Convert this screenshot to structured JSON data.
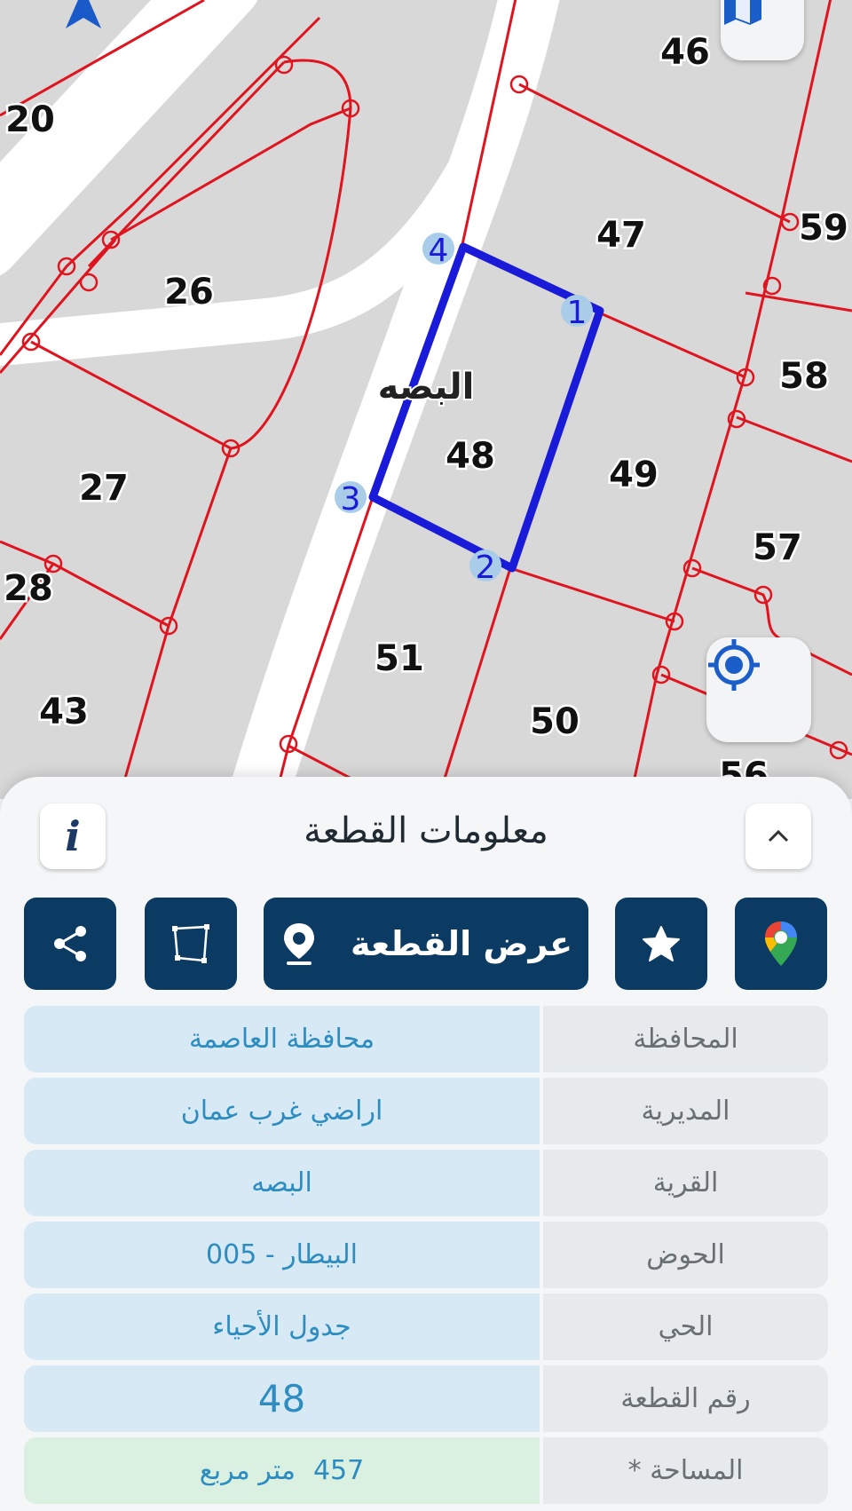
{
  "map": {
    "village_label": "البصه",
    "plot_numbers": [
      "46",
      "20",
      "47",
      "59",
      "26",
      "58",
      "48",
      "49",
      "27",
      "57",
      "28",
      "51",
      "43",
      "50",
      "56"
    ],
    "vertex_labels": [
      "1",
      "2",
      "3",
      "4"
    ],
    "colors": {
      "boundary": "#e0141e",
      "selection": "#1a1ad9",
      "road": "#ffffff",
      "land": "#d8d8d8",
      "vertex_fill": "#a9cde9"
    }
  },
  "sheet": {
    "title": "معلومات القطعة",
    "view_plot_label": "عرض القطعة",
    "colors": {
      "button_bg": "#0b3a63",
      "value_text": "#2d8cc0"
    }
  },
  "info": [
    {
      "key": "المحافظة",
      "value": "محافظة العاصمة"
    },
    {
      "key": "المديرية",
      "value": "اراضي غرب عمان"
    },
    {
      "key": "القرية",
      "value": "البصه"
    },
    {
      "key": "الحوض",
      "value": "البيطار - 005"
    },
    {
      "key": "الحي",
      "value": "جدول الأحياء"
    },
    {
      "key": "رقم القطعة",
      "value": "48"
    },
    {
      "key": "المساحة *",
      "value": "457",
      "unit": "متر مربع"
    }
  ]
}
